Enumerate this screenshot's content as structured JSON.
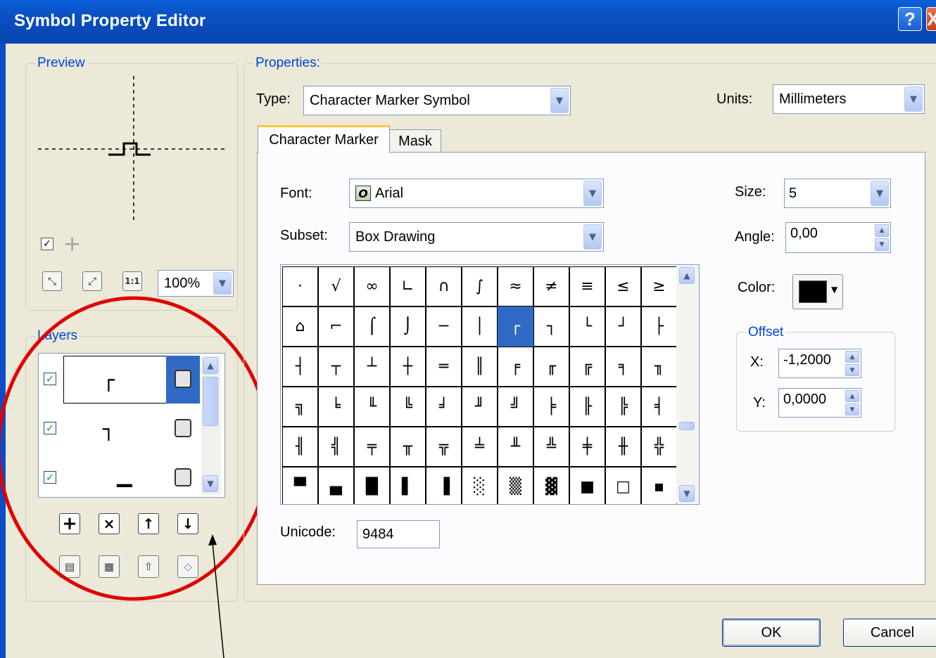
{
  "window": {
    "title": "Symbol Property Editor",
    "help_label": "?",
    "close_label": "X"
  },
  "preview": {
    "label": "Preview",
    "zoom_value": "100%",
    "zoom_buttons": [
      "fit-in",
      "fit-out",
      "1:1"
    ],
    "one_to_one_label": "1:1"
  },
  "layers": {
    "label": "Layers",
    "items": [
      {
        "checked": true,
        "glyph": "┌",
        "selected": true
      },
      {
        "checked": true,
        "glyph": "┐",
        "selected": false
      },
      {
        "checked": true,
        "glyph": "▁",
        "selected": false
      }
    ],
    "buttons": [
      "+",
      "×",
      "↑",
      "↓"
    ]
  },
  "properties": {
    "label": "Properties:",
    "type_label": "Type:",
    "type_value": "Character Marker Symbol",
    "units_label": "Units:",
    "units_value": "Millimeters"
  },
  "tabs": [
    {
      "label": "Character Marker",
      "active": true
    },
    {
      "label": "Mask",
      "active": false
    }
  ],
  "character_marker": {
    "font_label": "Font:",
    "font_value": "Arial",
    "subset_label": "Subset:",
    "subset_value": "Box Drawing",
    "size_label": "Size:",
    "size_value": "5",
    "angle_label": "Angle:",
    "angle_value": "0,00",
    "color_label": "Color:",
    "color_value": "#000000",
    "offset_label": "Offset",
    "x_label": "X:",
    "x_value": "-1,2000",
    "y_label": "Y:",
    "y_value": "0,0000",
    "unicode_label": "Unicode:",
    "unicode_value": "9484",
    "glyph_rows": [
      [
        "·",
        "√",
        "∞",
        "∟",
        "∩",
        "∫",
        "≈",
        "≠",
        "≡",
        "≤",
        "≥"
      ],
      [
        "⌂",
        "⌐",
        "⌠",
        "⌡",
        "─",
        "│",
        "┌",
        "┐",
        "└",
        "┘",
        "├"
      ],
      [
        "┤",
        "┬",
        "┴",
        "┼",
        "═",
        "║",
        "╒",
        "╓",
        "╔",
        "╕",
        "╖"
      ],
      [
        "╗",
        "╘",
        "╙",
        "╚",
        "╛",
        "╜",
        "╝",
        "╞",
        "╟",
        "╠",
        "╡"
      ],
      [
        "╢",
        "╣",
        "╤",
        "╥",
        "╦",
        "╧",
        "╨",
        "╩",
        "╪",
        "╫",
        "╬"
      ],
      [
        "▀",
        "▄",
        "█",
        "▌",
        "▐",
        "░",
        "▒",
        "▓",
        "■",
        "□",
        "▪"
      ]
    ],
    "selected_glyph": "┌"
  },
  "buttons": {
    "ok": "OK",
    "cancel": "Cancel"
  }
}
